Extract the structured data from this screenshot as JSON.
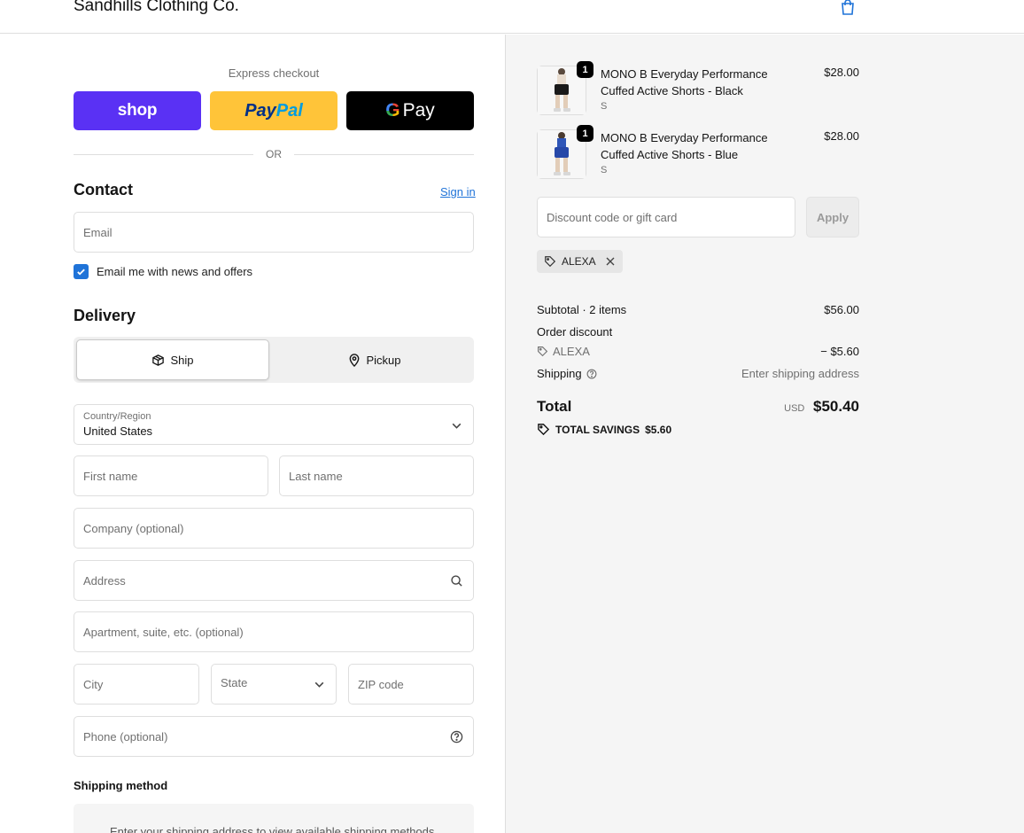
{
  "header": {
    "logo": "Sandhills Clothing Co."
  },
  "express": {
    "title": "Express checkout",
    "shop_label": "shop",
    "paypal_part1": "Pay",
    "paypal_part2": "Pal",
    "gpay_g": "G",
    "gpay_label": "Pay",
    "or_label": "OR"
  },
  "contact": {
    "title": "Contact",
    "signin": "Sign in",
    "email_placeholder": "Email",
    "newsletter_label": "Email me with news and offers"
  },
  "delivery": {
    "title": "Delivery",
    "ship_label": "Ship",
    "pickup_label": "Pickup",
    "country_label": "Country/Region",
    "country_value": "United States",
    "first_name": "First name",
    "last_name": "Last name",
    "company": "Company (optional)",
    "address": "Address",
    "apartment": "Apartment, suite, etc. (optional)",
    "city": "City",
    "state": "State",
    "zip": "ZIP code",
    "phone": "Phone (optional)"
  },
  "shipping_method": {
    "title": "Shipping method",
    "message": "Enter your shipping address to view available shipping methods."
  },
  "cart": {
    "items": [
      {
        "qty": "1",
        "name": "MONO B Everyday Performance Cuffed Active Shorts - Black",
        "variant": "S",
        "price": "$28.00"
      },
      {
        "qty": "1",
        "name": "MONO B Everyday Performance Cuffed Active Shorts - Blue",
        "variant": "S",
        "price": "$28.00"
      }
    ],
    "discount_placeholder": "Discount code or gift card",
    "apply_label": "Apply",
    "applied_code": "ALEXA"
  },
  "summary": {
    "subtotal_label": "Subtotal · 2 items",
    "subtotal_value": "$56.00",
    "order_discount_label": "Order discount",
    "discount_code": "ALEXA",
    "discount_value": "− $5.60",
    "shipping_label": "Shipping",
    "shipping_value": "Enter shipping address",
    "total_label": "Total",
    "currency": "USD",
    "total_value": "$50.40",
    "savings_label": "TOTAL SAVINGS",
    "savings_value": "$5.60"
  },
  "colors": {
    "accent": "#1f73d8",
    "shop_purple": "#5a31f4",
    "paypal_yellow": "#ffc439"
  }
}
